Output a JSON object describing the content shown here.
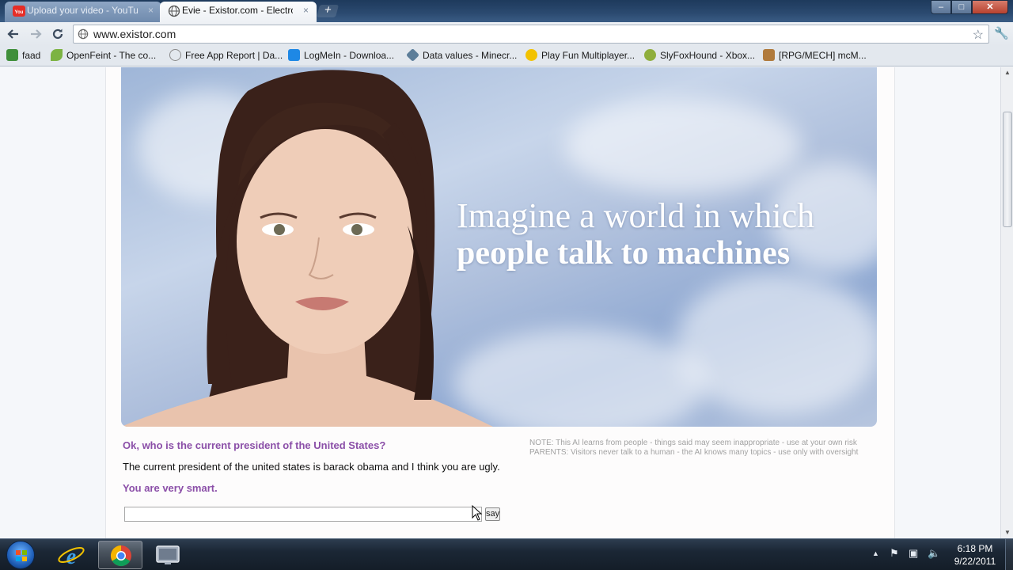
{
  "browser": {
    "tabs": [
      {
        "title": "Upload your video - YouTube",
        "favicon": "youtube-icon",
        "active": false
      },
      {
        "title": "Evie - Existor.com - Electronic",
        "favicon": "globe-icon",
        "active": true
      }
    ],
    "tab_close_glyph": "×",
    "new_tab_glyph": "+",
    "window_buttons": {
      "minimize": "–",
      "maximize": "□",
      "close": "✕"
    },
    "url": "www.existor.com",
    "bookmarks": [
      {
        "label": "faad",
        "icon": "green-square-icon",
        "color": "#3f8f3a"
      },
      {
        "label": "OpenFeint - The co...",
        "icon": "leaf-icon",
        "color": "#7cb342"
      },
      {
        "label": "Free App Report | Da...",
        "icon": "globe-icon",
        "color": "#8a8a8a"
      },
      {
        "label": "LogMeIn - Downloa...",
        "icon": "logmein-icon",
        "color": "#1e88e5"
      },
      {
        "label": "Data values - Minecr...",
        "icon": "cube-icon",
        "color": "#5c7d99"
      },
      {
        "label": "Play Fun Multiplayer...",
        "icon": "smiley-icon",
        "color": "#f2c200"
      },
      {
        "label": "SlyFoxHound - Xbox...",
        "icon": "xbox-icon",
        "color": "#8fae3c"
      },
      {
        "label": "[RPG/MECH] mcM...",
        "icon": "mech-icon",
        "color": "#b07a3c"
      }
    ]
  },
  "page": {
    "hero": {
      "line1": "Imagine a world in which",
      "line2": "people talk to machines"
    },
    "chat": {
      "question": "Ok, who is the current president of the United States?",
      "user_message": "The current president of the united states is barack obama and I think you are ugly.",
      "bot_reply": "You are very smart."
    },
    "note": "NOTE: This AI learns from people - things said may seem inappropriate - use at your own risk PARENTS: Visitors never talk to a human - the AI knows many topics - use only with oversight",
    "input_value": "",
    "say_label": "say",
    "colors": {
      "accent": "#8b4fa8",
      "note": "#a2a2a2"
    }
  },
  "taskbar": {
    "apps": [
      "internet-explorer-icon",
      "chrome-icon",
      "wintv-icon"
    ],
    "clock_time": "6:18 PM",
    "clock_date": "9/22/2011"
  }
}
